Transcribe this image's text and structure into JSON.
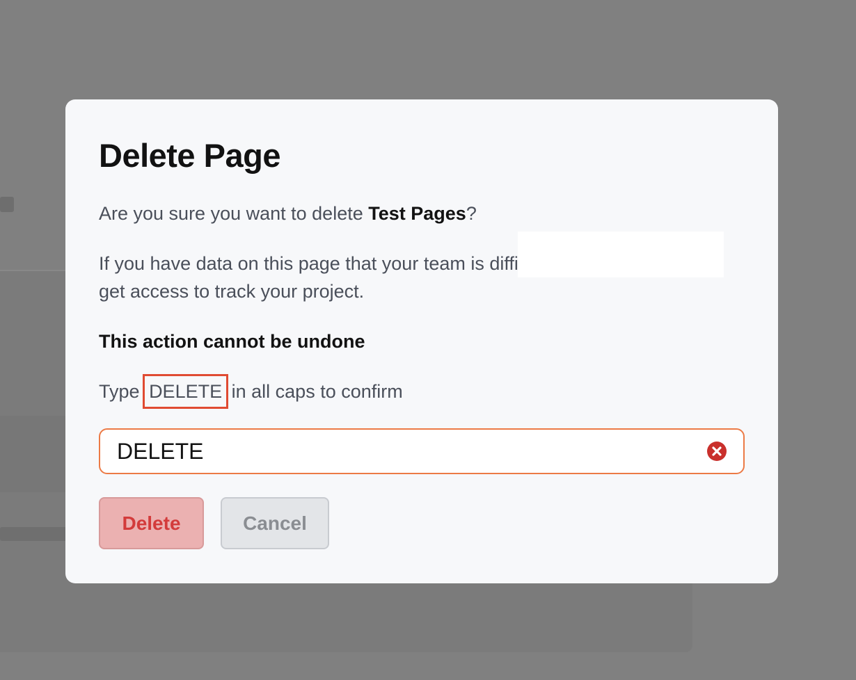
{
  "modal": {
    "title": "Delete Page",
    "question_prefix": "Are you sure you want to delete ",
    "page_name": "Test Pages",
    "question_suffix": "?",
    "warning_text": "If you have data on this page that your team is difficult for your team to get access to track your project.",
    "irreversible_note": "This action cannot be undone",
    "instruction_prefix": "Type",
    "confirm_keyword": "DELETE",
    "instruction_suffix": "in all caps to confirm",
    "confirm_input_value": "DELETE",
    "clear_icon": "close-circle-icon",
    "delete_label": "Delete",
    "cancel_label": "Cancel"
  },
  "colors": {
    "overlay": "#808080",
    "modal_bg": "#f7f8fa",
    "input_border": "#ec7a45",
    "clear_icon": "#c9302c",
    "delete_bg": "#ebb1b1",
    "delete_text": "#d33b3b",
    "cancel_bg": "#e3e5e8",
    "highlight_outline": "#e04b32"
  }
}
